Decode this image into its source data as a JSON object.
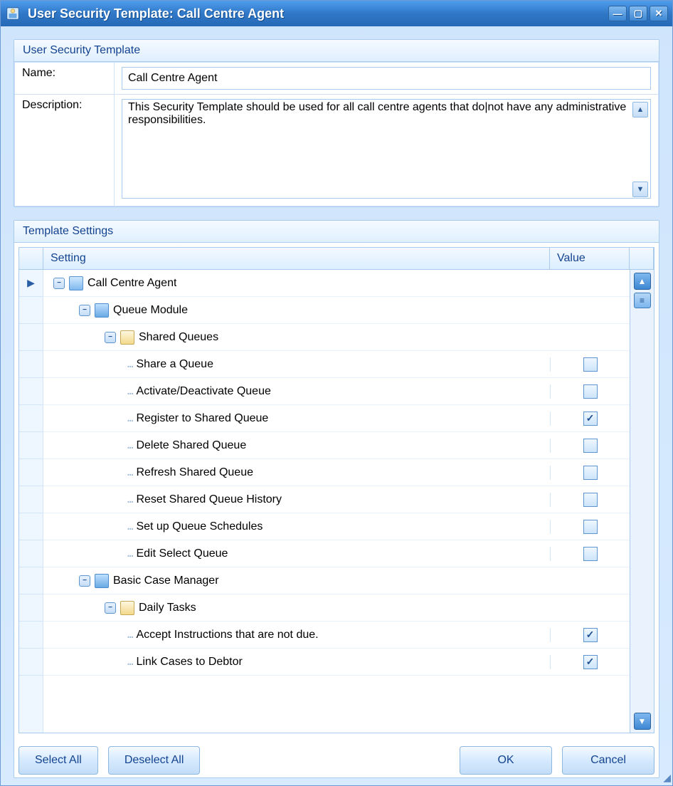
{
  "window": {
    "title": "User Security Template: Call Centre Agent"
  },
  "group1": {
    "title": "User Security Template"
  },
  "labels": {
    "name": "Name:",
    "description": "Description:"
  },
  "form": {
    "name": "Call Centre Agent",
    "description": "This Security Template should be used for all call centre agents that do|not have any administrative responsibilities."
  },
  "group2": {
    "title": "Template Settings"
  },
  "grid": {
    "col_setting": "Setting",
    "col_value": "Value"
  },
  "rows": [
    {
      "indent": 0,
      "toggle": "-",
      "icon": "agent",
      "label": "Call Centre Agent",
      "value": null,
      "selector": "▶"
    },
    {
      "indent": 1,
      "toggle": "-",
      "icon": "module",
      "label": "Queue Module",
      "value": null,
      "selector": ""
    },
    {
      "indent": 2,
      "toggle": "-",
      "icon": "folder",
      "label": "Shared Queues",
      "value": null,
      "selector": ""
    },
    {
      "indent": 3,
      "toggle": "",
      "icon": "",
      "label": "Share a Queue",
      "value": false,
      "selector": ""
    },
    {
      "indent": 3,
      "toggle": "",
      "icon": "",
      "label": "Activate/Deactivate Queue",
      "value": false,
      "selector": ""
    },
    {
      "indent": 3,
      "toggle": "",
      "icon": "",
      "label": "Register to Shared Queue",
      "value": true,
      "selector": ""
    },
    {
      "indent": 3,
      "toggle": "",
      "icon": "",
      "label": "Delete Shared Queue",
      "value": false,
      "selector": ""
    },
    {
      "indent": 3,
      "toggle": "",
      "icon": "",
      "label": "Refresh Shared Queue",
      "value": false,
      "selector": ""
    },
    {
      "indent": 3,
      "toggle": "",
      "icon": "",
      "label": "Reset Shared Queue History",
      "value": false,
      "selector": ""
    },
    {
      "indent": 3,
      "toggle": "",
      "icon": "",
      "label": "Set up Queue Schedules",
      "value": false,
      "selector": ""
    },
    {
      "indent": 3,
      "toggle": "",
      "icon": "",
      "label": "Edit Select Queue",
      "value": false,
      "selector": ""
    },
    {
      "indent": 1,
      "toggle": "-",
      "icon": "module",
      "label": "Basic Case Manager",
      "value": null,
      "selector": ""
    },
    {
      "indent": 2,
      "toggle": "-",
      "icon": "folder",
      "label": "Daily Tasks",
      "value": null,
      "selector": ""
    },
    {
      "indent": 3,
      "toggle": "",
      "icon": "",
      "label": "Accept Instructions that are not due.",
      "value": true,
      "selector": ""
    },
    {
      "indent": 3,
      "toggle": "",
      "icon": "",
      "label": "Link Cases to Debtor",
      "value": true,
      "selector": ""
    }
  ],
  "buttons": {
    "select_all": "Select All",
    "deselect_all": "Deselect All",
    "ok": "OK",
    "cancel": "Cancel"
  }
}
